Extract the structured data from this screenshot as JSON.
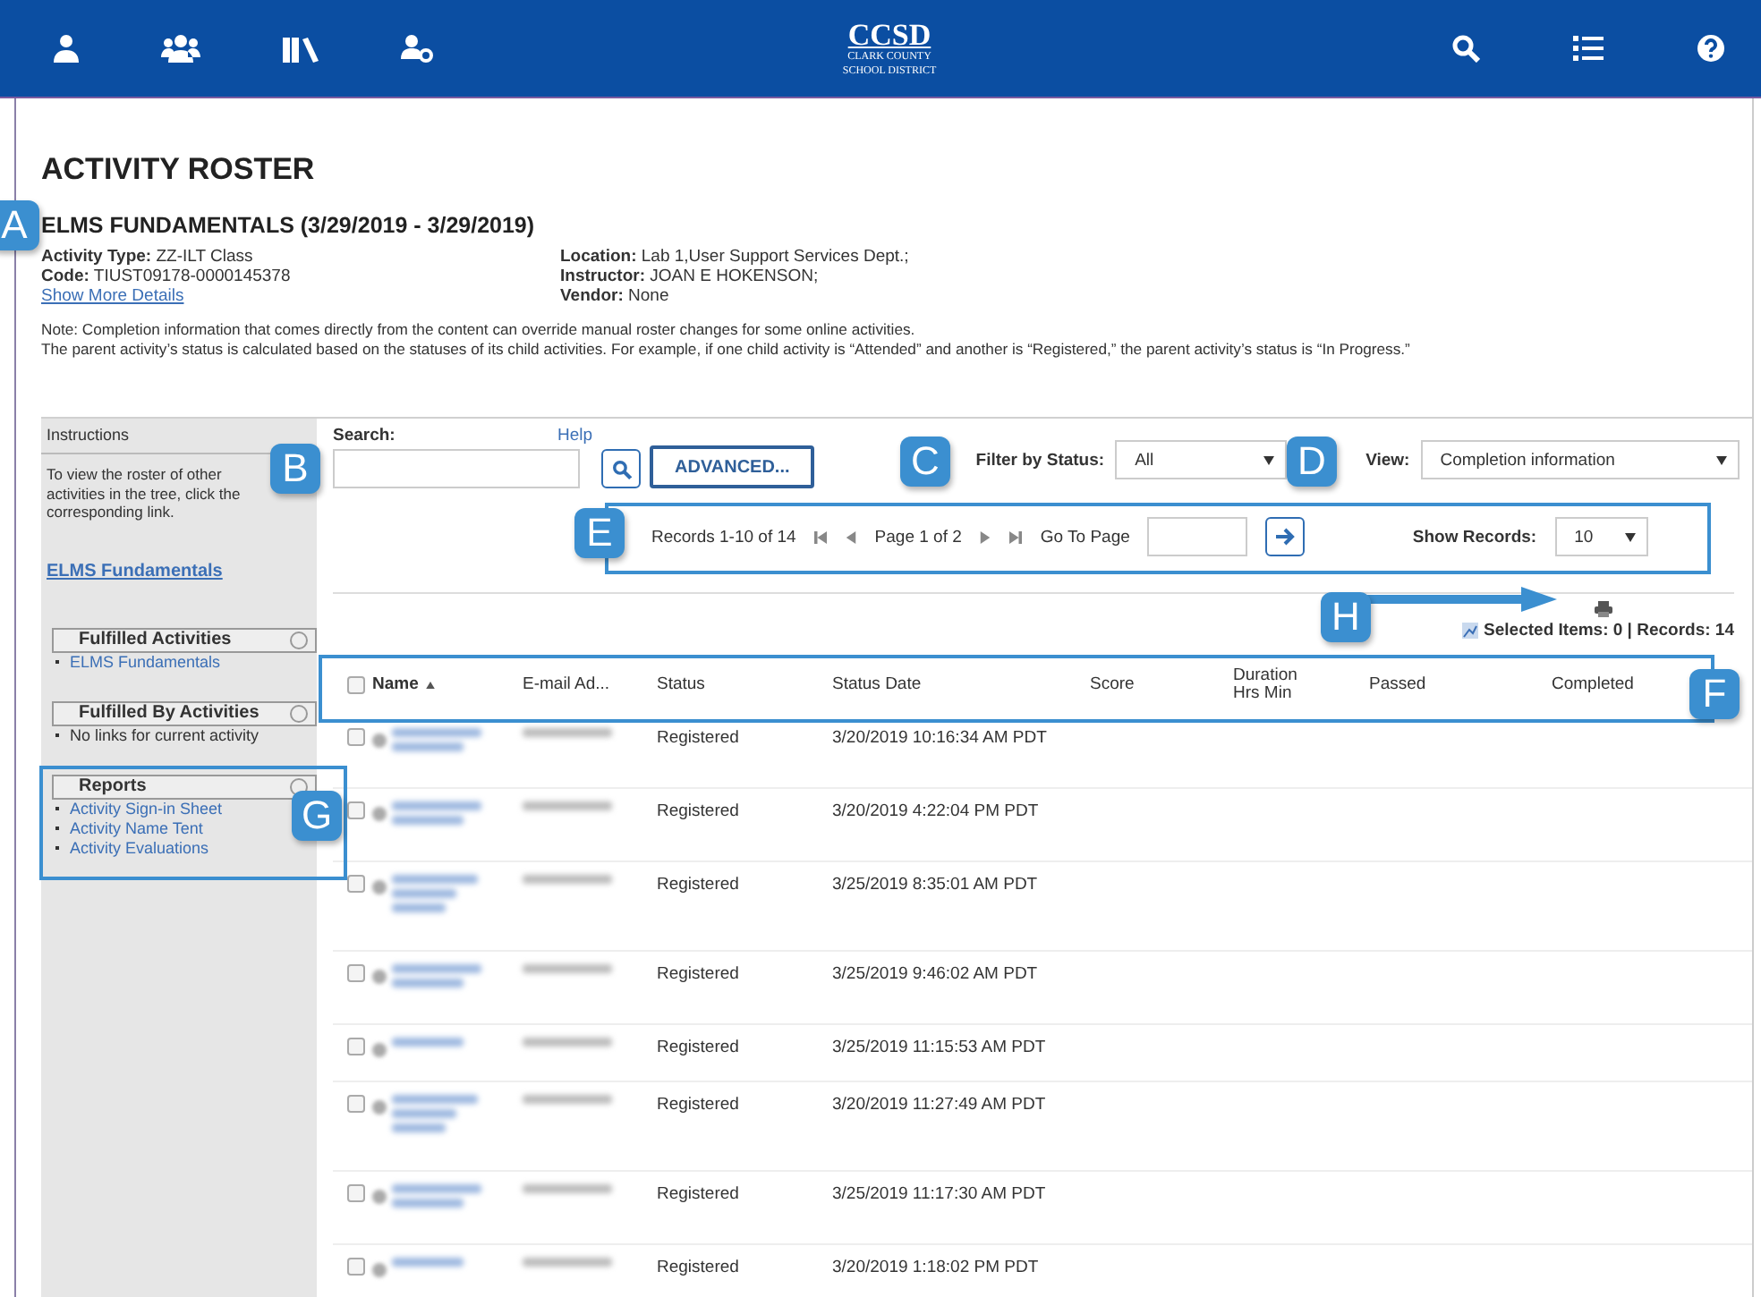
{
  "header": {
    "logo": {
      "title": "CCSD",
      "line_1": "CLARK COUNTY",
      "line_2": "SCHOOL DISTRICT"
    }
  },
  "page_title": "ACTIVITY ROSTER",
  "activity": {
    "title": "ELMS FUNDAMENTALS (3/29/2019 - 3/29/2019)",
    "details_left": [
      {
        "label": "Activity Type:",
        "value": "ZZ-ILT Class"
      },
      {
        "label": "Code:",
        "value": "TIUST09178-0000145378"
      }
    ],
    "show_more": "Show More Details",
    "details_right": [
      {
        "label": "Location:",
        "value": "Lab 1,User Support Services Dept.;"
      },
      {
        "label": "Instructor:",
        "value": "JOAN E HOKENSON;"
      },
      {
        "label": "Vendor:",
        "value": "None"
      }
    ]
  },
  "notes": [
    "Note: Completion information that comes directly from the content can override manual roster changes for some online activities.",
    "The parent activity’s status is calculated based on the statuses of its child activities. For example, if one child activity is “Attended” and another is “Registered,” the parent activity’s status is “In Progress.”"
  ],
  "sidebar": {
    "instructions_title": "Instructions",
    "instructions_text": "To view the roster of other activities in the tree, click the corresponding link.",
    "current_link": "ELMS Fundamentals",
    "sections": [
      {
        "title": "Fulfilled Activities",
        "items": [
          {
            "kind": "link",
            "text": "ELMS Fundamentals"
          }
        ]
      },
      {
        "title": "Fulfilled By Activities",
        "items": [
          {
            "kind": "text",
            "text": "No links for current activity"
          }
        ]
      },
      {
        "title": "Reports",
        "items": [
          {
            "kind": "link",
            "text": "Activity Sign-in Sheet"
          },
          {
            "kind": "link",
            "text": "Activity Name Tent"
          },
          {
            "kind": "link",
            "text": "Activity Evaluations"
          }
        ]
      }
    ]
  },
  "search": {
    "label": "Search:",
    "help": "Help",
    "advanced": "ADVANCED..."
  },
  "filter": {
    "label": "Filter by Status:",
    "value": "All"
  },
  "view": {
    "label": "View:",
    "value": "Completion information"
  },
  "pager": {
    "records": "Records 1-10 of 14",
    "page": "Page 1 of 2",
    "go_to": "Go To Page",
    "show_label": "Show Records:",
    "show_value": "10"
  },
  "summary": "Selected Items:  0  | Records:  14",
  "table": {
    "select_all_checked": false,
    "columns": [
      {
        "label": "Name",
        "sorted": true
      },
      {
        "label": "E-mail Ad...",
        "sorted": false
      },
      {
        "label": "Status",
        "sorted": false
      },
      {
        "label": "Status Date",
        "sorted": false
      },
      {
        "label": "Score",
        "sorted": false
      },
      {
        "label": "Duration",
        "sub": "Hrs   Min",
        "sorted": false
      },
      {
        "label": "Passed",
        "sorted": false
      },
      {
        "label": "Completed",
        "sorted": false
      }
    ],
    "rows": [
      {
        "checked": false,
        "status": "Registered",
        "date": "3/20/2019 10:16:34 AM PDT"
      },
      {
        "checked": false,
        "status": "Registered",
        "date": "3/20/2019 4:22:04 PM PDT"
      },
      {
        "checked": false,
        "status": "Registered",
        "date": "3/25/2019 8:35:01 AM PDT"
      },
      {
        "checked": false,
        "status": "Registered",
        "date": "3/25/2019 9:46:02 AM PDT"
      },
      {
        "checked": false,
        "status": "Registered",
        "date": "3/25/2019 11:15:53 AM PDT"
      },
      {
        "checked": false,
        "status": "Registered",
        "date": "3/20/2019 11:27:49 AM PDT"
      },
      {
        "checked": false,
        "status": "Registered",
        "date": "3/25/2019 11:17:30 AM PDT"
      },
      {
        "checked": false,
        "status": "Registered",
        "date": "3/20/2019 1:18:02 PM PDT"
      }
    ]
  },
  "callouts": [
    "A",
    "B",
    "C",
    "D",
    "E",
    "F",
    "G",
    "H"
  ]
}
